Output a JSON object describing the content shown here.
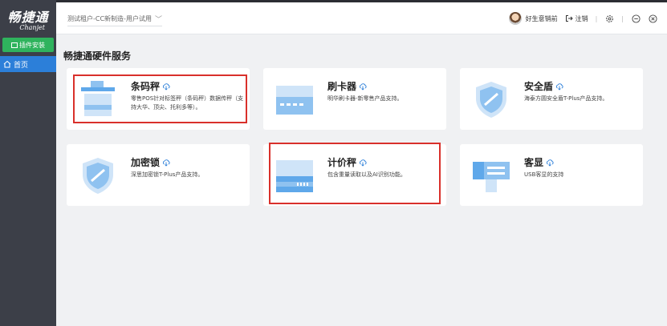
{
  "app": {
    "logo_cn": "畅捷通",
    "logo_en": "Chanjet"
  },
  "sidebar": {
    "plugin_install_label": "插件安装",
    "home_label": "首页"
  },
  "header": {
    "tenant_label": "测试租户-CC新制造-用户试用",
    "user_name": "好生意销前",
    "logout_label": "注销"
  },
  "main": {
    "section_title": "畅捷通硬件服务",
    "cards": [
      {
        "title": "条码秤",
        "desc": "零售POS针对标签秤（条码秤）数据传秤（支持大华、顶尖、托利多等）。"
      },
      {
        "title": "刷卡器",
        "desc": "明华刷卡器-新零售产品支持。"
      },
      {
        "title": "安全盾",
        "desc": "海泰方圆安全盾T-Plus产品支持。"
      },
      {
        "title": "加密锁",
        "desc": "深思加密锁T-Plus产品支持。"
      },
      {
        "title": "计价秤",
        "desc": "包含重量读取以及AI识别功能。"
      },
      {
        "title": "客显",
        "desc": "USB客显的支持"
      }
    ]
  },
  "colors": {
    "sidebar_bg": "#3c3f48",
    "accent_blue": "#2c7fd9",
    "install_green": "#2fb35d",
    "highlight_red": "#d9302b",
    "illustration_blue": "#8fc2f0"
  },
  "icons": {
    "download": "cloud-download-icon",
    "logout": "logout-icon",
    "settings": "gear-icon",
    "minimize": "minimize-icon",
    "close": "close-icon",
    "home": "home-icon"
  }
}
